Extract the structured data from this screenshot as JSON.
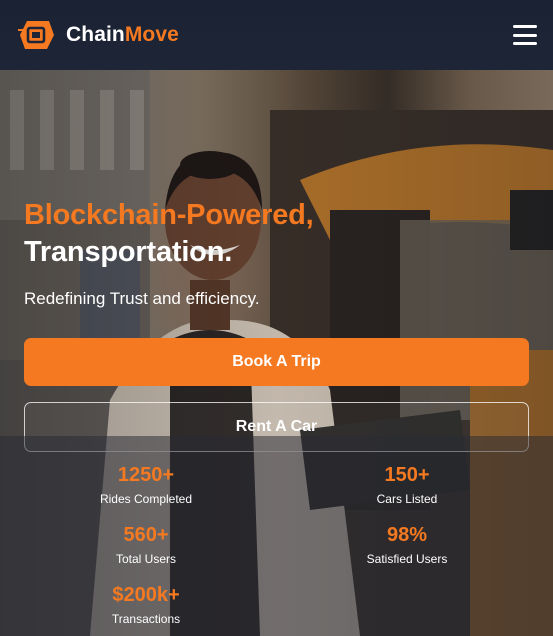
{
  "header": {
    "brand_part1": "Chain",
    "brand_part2": "Move",
    "logo_icon": "chainmove-logo-icon",
    "menu_icon": "hamburger-menu-icon"
  },
  "hero": {
    "headline_line1": "Blockchain-Powered,",
    "headline_line2": "Transportation.",
    "subheadline": "Redefining Trust and efficiency.",
    "primary_button": "Book A Trip",
    "secondary_button": "Rent A Car"
  },
  "stats": [
    {
      "value": "1250+",
      "label": "Rides Completed"
    },
    {
      "value": "150+",
      "label": "Cars Listed"
    },
    {
      "value": "560+",
      "label": "Total Users"
    },
    {
      "value": "98%",
      "label": "Satisfied Users"
    },
    {
      "value": "$200k+",
      "label": "Transactions"
    }
  ],
  "colors": {
    "accent": "#f47920",
    "header_bg": "#1d2537",
    "text": "#ffffff"
  }
}
